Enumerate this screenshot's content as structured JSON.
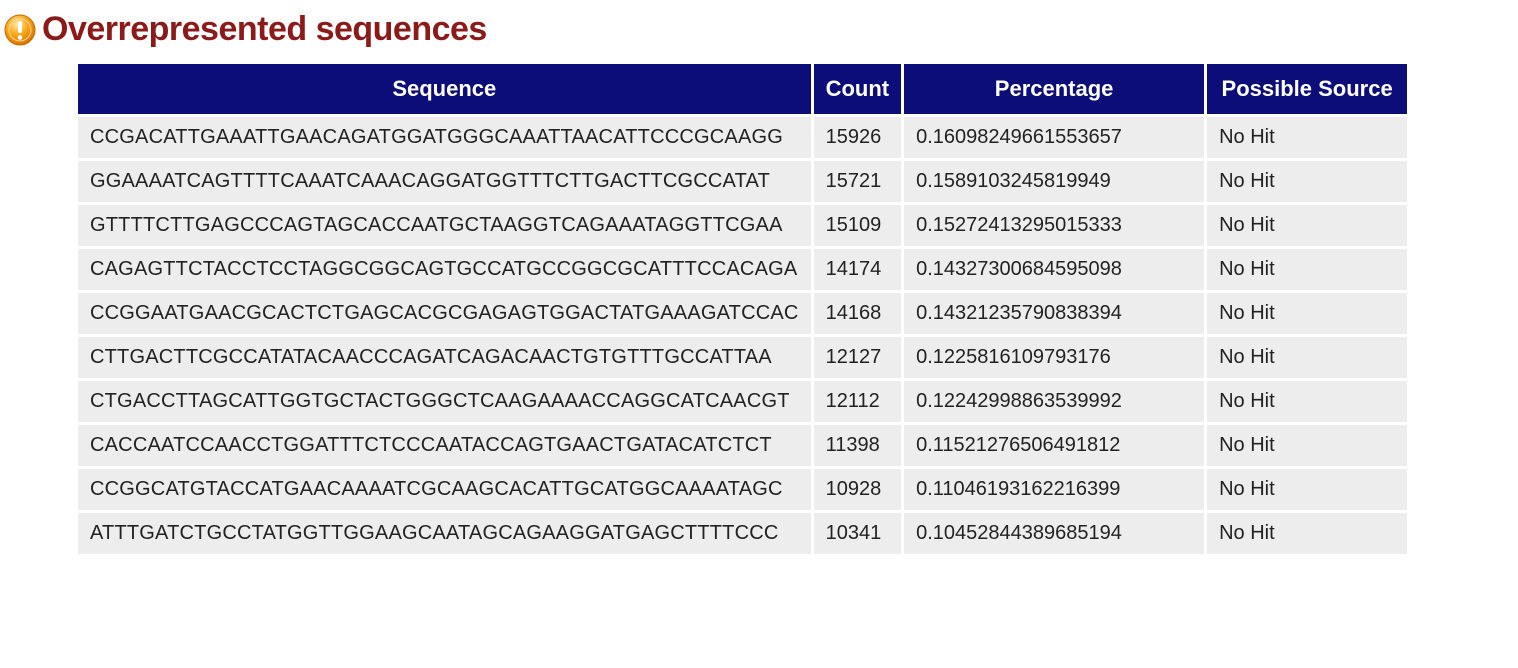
{
  "section": {
    "title": "Overrepresented sequences",
    "status": "warning"
  },
  "table": {
    "headers": {
      "sequence": "Sequence",
      "count": "Count",
      "percentage": "Percentage",
      "source": "Possible Source"
    },
    "rows": [
      {
        "sequence": "CCGACATTGAAATTGAACAGATGGATGGGCAAATTAACATTCCCGCAAGG",
        "count": "15926",
        "percentage": "0.16098249661553657",
        "source": "No Hit"
      },
      {
        "sequence": "GGAAAATCAGTTTTCAAATCAAACAGGATGGTTTCTTGACTTCGCCATAT",
        "count": "15721",
        "percentage": "0.1589103245819949",
        "source": "No Hit"
      },
      {
        "sequence": "GTTTTCTTGAGCCCAGTAGCACCAATGCTAAGGTCAGAAATAGGTTCGAA",
        "count": "15109",
        "percentage": "0.15272413295015333",
        "source": "No Hit"
      },
      {
        "sequence": "CAGAGTTCTACCTCCTAGGCGGCAGTGCCATGCCGGCGCATTTCCACAGA",
        "count": "14174",
        "percentage": "0.14327300684595098",
        "source": "No Hit"
      },
      {
        "sequence": "CCGGAATGAACGCACTCTGAGCACGCGAGAGTGGACTATGAAAGATCCAC",
        "count": "14168",
        "percentage": "0.14321235790838394",
        "source": "No Hit"
      },
      {
        "sequence": "CTTGACTTCGCCATATACAACCCAGATCAGACAACTGTGTTTGCCATTAA",
        "count": "12127",
        "percentage": "0.1225816109793176",
        "source": "No Hit"
      },
      {
        "sequence": "CTGACCTTAGCATTGGTGCTACTGGGCTCAAGAAAACCAGGCATCAACGT",
        "count": "12112",
        "percentage": "0.12242998863539992",
        "source": "No Hit"
      },
      {
        "sequence": "CACCAATCCAACCTGGATTTCTCCCAATACCAGTGAACTGATACATCTCT",
        "count": "11398",
        "percentage": "0.11521276506491812",
        "source": "No Hit"
      },
      {
        "sequence": "CCGGCATGTACCATGAACAAAATCGCAAGCACATTGCATGGCAAAATAGC",
        "count": "10928",
        "percentage": "0.11046193162216399",
        "source": "No Hit"
      },
      {
        "sequence": "ATTTGATCTGCCTATGGTTGGAAGCAATAGCAGAAGGATGAGCTTTTCCC",
        "count": "10341",
        "percentage": "0.10452844389685194",
        "source": "No Hit"
      }
    ]
  }
}
